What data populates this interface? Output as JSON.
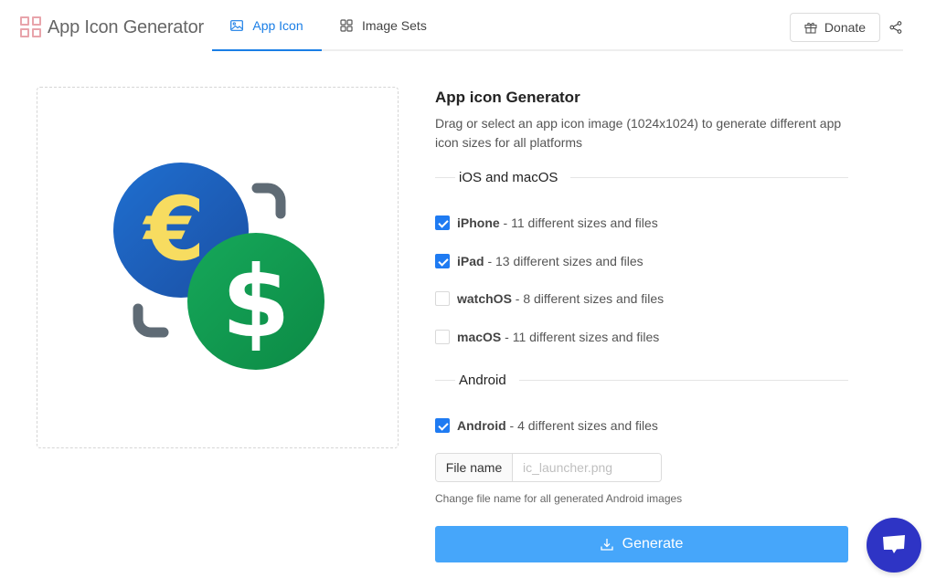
{
  "header": {
    "brand_title": "App Icon Generator",
    "tabs": [
      {
        "label": "App Icon",
        "icon": "image-icon",
        "active": true
      },
      {
        "label": "Image Sets",
        "icon": "grid-icon",
        "active": false
      }
    ],
    "donate_label": "Donate",
    "accent_color": "#1a7ee6"
  },
  "dropzone": {
    "image": "currency-exchange-icon",
    "alt": "Euro and Dollar exchange app icon"
  },
  "panel": {
    "title": "App icon Generator",
    "description": "Drag or select an app icon image (1024x1024) to generate different app icon sizes for all platforms",
    "sections": {
      "ios": {
        "label": "iOS and macOS",
        "options": [
          {
            "name": "iPhone",
            "detail": " - 11 different sizes and files",
            "checked": true
          },
          {
            "name": "iPad",
            "detail": " - 13 different sizes and files",
            "checked": true
          },
          {
            "name": "watchOS",
            "detail": " - 8 different sizes and files",
            "checked": false
          },
          {
            "name": "macOS",
            "detail": " - 11 different sizes and files",
            "checked": false
          }
        ]
      },
      "android": {
        "label": "Android",
        "options": [
          {
            "name": "Android",
            "detail": " - 4 different sizes and files",
            "checked": true
          }
        ],
        "filename_label": "File name",
        "filename_value": "",
        "filename_placeholder": "ic_launcher.png",
        "filename_help": "Change file name for all generated Android images"
      }
    },
    "generate_label": "Generate"
  },
  "chat": {
    "icon": "chat-bubble-icon"
  }
}
